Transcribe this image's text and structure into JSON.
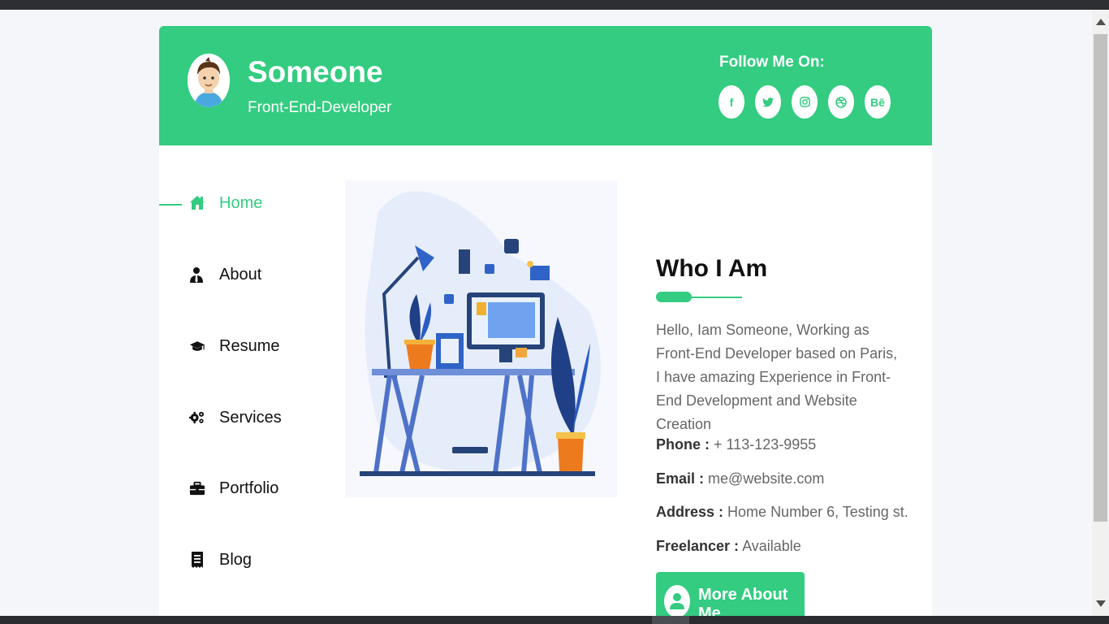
{
  "header": {
    "name": "Someone",
    "role": "Front-End-Developer",
    "follow_label": "Follow Me On:",
    "socials": [
      {
        "name": "facebook",
        "glyph": "f"
      },
      {
        "name": "twitter",
        "glyph": "t"
      },
      {
        "name": "instagram",
        "glyph": "◎"
      },
      {
        "name": "dribbble",
        "glyph": "✺"
      },
      {
        "name": "behance",
        "glyph": "Bē"
      }
    ]
  },
  "nav": {
    "items": [
      {
        "label": "Home",
        "icon": "home-icon",
        "active": true
      },
      {
        "label": "About",
        "icon": "user-tie-icon"
      },
      {
        "label": "Resume",
        "icon": "graduation-cap-icon"
      },
      {
        "label": "Services",
        "icon": "gears-icon"
      },
      {
        "label": "Portfolio",
        "icon": "briefcase-icon"
      },
      {
        "label": "Blog",
        "icon": "receipt-icon"
      }
    ]
  },
  "about": {
    "title": "Who I Am",
    "intro": "Hello, Iam Someone, Working as Front-End Developer based on Paris, I have amazing Experience in Front-End Development and Website Creation",
    "phone_label": "Phone :",
    "phone_value": "+ 113-123-9955",
    "email_label": "Email :",
    "email_value": "me@website.com",
    "address_label": "Address :",
    "address_value": "Home Number 6, Testing st.",
    "freelancer_label": "Freelancer :",
    "freelancer_value": "Available",
    "button_label": "More About Me"
  },
  "colors": {
    "accent": "#33cc80",
    "text_dark": "#111111",
    "text_muted": "#666666"
  }
}
